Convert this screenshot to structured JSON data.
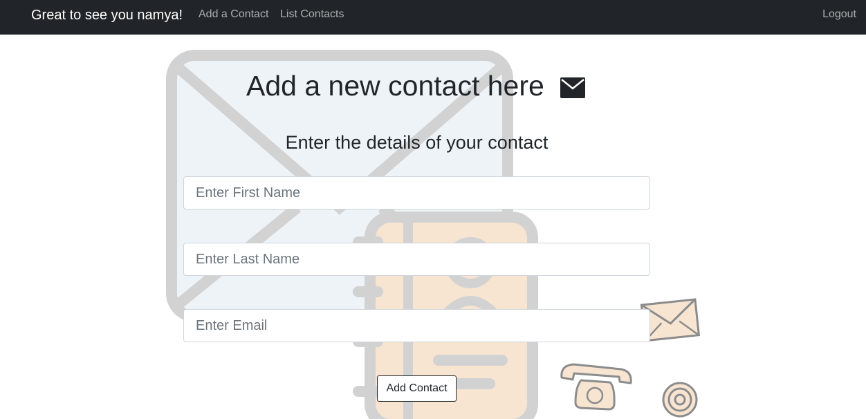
{
  "navbar": {
    "brand": "Great to see you namya!",
    "links": [
      {
        "label": "Add a Contact"
      },
      {
        "label": "List Contacts"
      }
    ],
    "logout": "Logout"
  },
  "main": {
    "title": "Add a new contact here",
    "title_icon": "envelope-icon",
    "subtitle": "Enter the details of your contact"
  },
  "form": {
    "first_name": {
      "value": "",
      "placeholder": "Enter First Name"
    },
    "last_name": {
      "value": "",
      "placeholder": "Enter Last Name"
    },
    "email": {
      "value": "",
      "placeholder": "Enter Email"
    },
    "submit_label": "Add Contact"
  },
  "colors": {
    "navbar_bg": "#212529",
    "illustration_gray": "#d2d2d2",
    "illustration_peach": "#f7e5d2",
    "illustration_light": "#eef3f8"
  }
}
